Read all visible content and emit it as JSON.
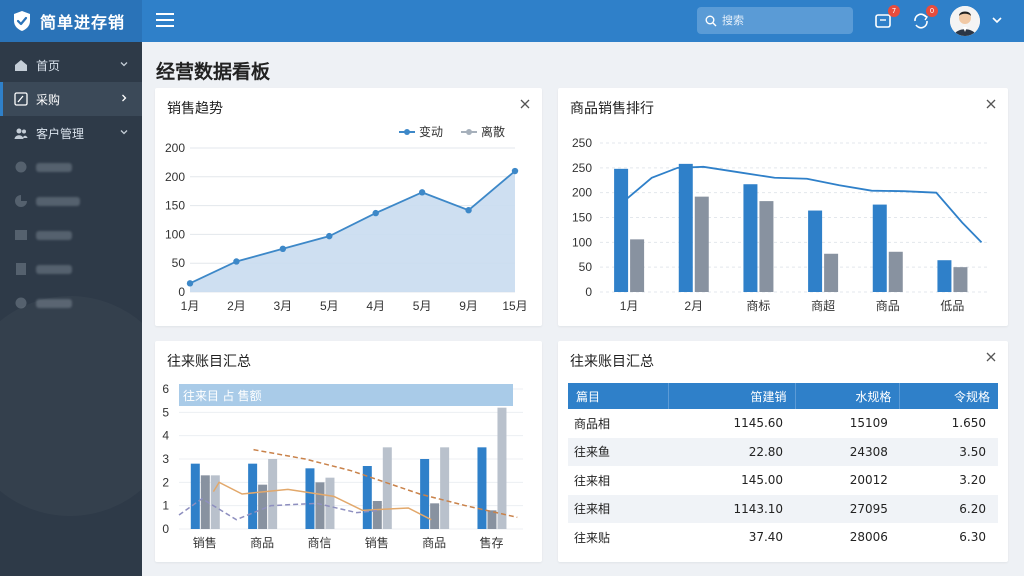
{
  "app": {
    "brand": "简单进存销",
    "search_placeholder": "搜索",
    "notifications_badge": "7",
    "messages_badge": "0"
  },
  "sidebar": {
    "items": [
      {
        "label": "首页",
        "icon": "home-icon",
        "active": false
      },
      {
        "label": "采购",
        "icon": "edit-icon",
        "active": true
      },
      {
        "label": "客户管理",
        "icon": "users-icon",
        "active": false
      }
    ]
  },
  "page": {
    "title": "经营数据看板"
  },
  "cards": {
    "sales_trend": {
      "title": "销售趋势"
    },
    "ranking": {
      "title": "商品销售排行"
    },
    "accounts_chart": {
      "title": "往来账目汇总"
    },
    "accounts_table": {
      "title": "往来账目汇总"
    }
  },
  "chart_data": [
    {
      "type": "area",
      "title": "销售趋势",
      "categories": [
        "1月",
        "2月",
        "3月",
        "5月",
        "4月",
        "5月",
        "9月",
        "15月"
      ],
      "series": [
        {
          "name": "变动",
          "values": [
            15,
            53,
            75,
            97,
            137,
            173,
            142,
            210
          ],
          "color": "#3d88c8"
        },
        {
          "name": "离散",
          "values": [],
          "color": "#a6b0bb"
        }
      ],
      "y_ticks": [
        0,
        50,
        100,
        150,
        200,
        200
      ],
      "ylim": [
        0,
        250
      ],
      "grid": true,
      "legend": "top-right"
    },
    {
      "type": "bar",
      "title": "商品销售排行",
      "categories": [
        "1月",
        "2月",
        "商标",
        "商超",
        "商品",
        "低品"
      ],
      "series": [
        {
          "values": [
            248,
            258,
            217,
            164,
            176,
            64
          ],
          "color": "#2f80c9"
        },
        {
          "values": [
            106,
            192,
            183,
            77,
            81,
            50
          ],
          "color": "#8892a0"
        }
      ],
      "line": {
        "values": [
          [
            0.3,
            175
          ],
          [
            0.8,
            230
          ],
          [
            1.2,
            250
          ],
          [
            1.6,
            252
          ],
          [
            2.2,
            240
          ],
          [
            2.7,
            230
          ],
          [
            3.2,
            228
          ],
          [
            3.7,
            215
          ],
          [
            4.2,
            204
          ],
          [
            4.7,
            203
          ],
          [
            5.2,
            200
          ],
          [
            5.6,
            140
          ],
          [
            5.9,
            100
          ]
        ],
        "color": "#2f80c9"
      },
      "y_ticks": [
        0,
        50,
        100,
        150,
        200,
        250,
        250
      ],
      "ylim": [
        0,
        300
      ],
      "grid": true
    },
    {
      "type": "bar",
      "title": "往来账目汇总",
      "header_text": "往来目 占 售额",
      "categories": [
        "销售",
        "商品",
        "商信",
        "销售",
        "商品",
        "售存"
      ],
      "series": [
        {
          "values": [
            2.8,
            2.8,
            2.6,
            2.7,
            3.0,
            3.5
          ],
          "color": "#2f80c9"
        },
        {
          "values": [
            2.3,
            1.9,
            2.0,
            1.2,
            1.1,
            0.8
          ],
          "color": "#8892a0"
        },
        {
          "values": [
            2.3,
            3.0,
            2.2,
            3.5,
            3.5,
            5.2
          ],
          "color": "#b9c1cc"
        }
      ],
      "lines": [
        {
          "values": [
            [
              0.6,
              1.6
            ],
            [
              0.7,
              2.0
            ],
            [
              1.1,
              1.5
            ],
            [
              1.9,
              1.7
            ],
            [
              2.7,
              1.4
            ],
            [
              3.2,
              0.8
            ],
            [
              4.0,
              0.9
            ],
            [
              4.4,
              0.4
            ]
          ],
          "color": "#e2a86b"
        },
        {
          "values": [
            [
              1.3,
              3.4
            ],
            [
              2.2,
              3.0
            ],
            [
              3.0,
              2.5
            ],
            [
              4.2,
              1.5
            ],
            [
              5.0,
              1.0
            ],
            [
              5.9,
              0.5
            ]
          ],
          "color": "#c9824a",
          "dashed": true
        },
        {
          "values": [
            [
              0.0,
              0.6
            ],
            [
              0.4,
              1.3
            ],
            [
              1.0,
              0.4
            ],
            [
              1.6,
              1.0
            ],
            [
              2.4,
              1.1
            ],
            [
              3.1,
              0.7
            ],
            [
              3.5,
              0.8
            ]
          ],
          "color": "#8e8fbf",
          "dashed": true
        }
      ],
      "y_ticks": [
        0,
        1,
        2,
        3,
        4,
        5,
        6
      ],
      "ylim": [
        0,
        6
      ]
    }
  ],
  "accounts_table": {
    "headers": [
      "篇目",
      "笛建销",
      "水规格",
      "令规格"
    ],
    "rows": [
      [
        "商品相",
        "1145.60",
        "15109",
        "1.650"
      ],
      [
        "往来鱼",
        "22.80",
        "24308",
        "3.50"
      ],
      [
        "往来相",
        "145.00",
        "20012",
        "3.20"
      ],
      [
        "往来相",
        "1143.10",
        "27095",
        "6.20"
      ],
      [
        "往来贴",
        "37.40",
        "28006",
        "6.30"
      ]
    ]
  },
  "colors": {
    "accent": "#2f80c9",
    "sidebar": "#2e3a48",
    "bar_gray": "#8892a0"
  }
}
